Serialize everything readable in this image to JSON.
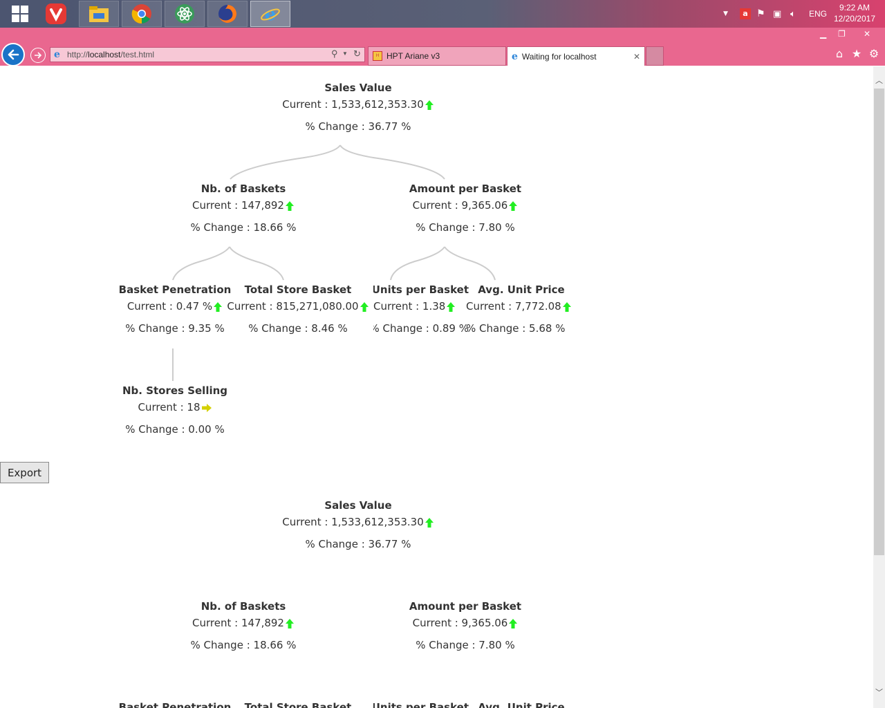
{
  "taskbar": {
    "apps": [
      "vivaldi-icon",
      "file-explorer-icon",
      "chrome-icon",
      "atom-icon",
      "firefox-icon",
      "internet-explorer-icon"
    ],
    "tray": {
      "language": "ENG"
    },
    "clock": {
      "time": "9:22 AM",
      "date": "12/20/2017"
    }
  },
  "browser": {
    "address": {
      "prefix": "http://",
      "host": "localhost",
      "path": "/test.html"
    },
    "tabs": [
      {
        "label": "HPT Ariane v3",
        "active": false
      },
      {
        "label": "Waiting for localhost",
        "active": true
      }
    ]
  },
  "tree1": {
    "root": {
      "title": "Sales Value",
      "current": "Current : 1,533,612,353.30",
      "change": "% Change : 36.77 %",
      "trend": "up"
    },
    "n1": {
      "title": "Nb. of Baskets",
      "current": "Current : 147,892",
      "change": "% Change : 18.66 %",
      "trend": "up"
    },
    "n2": {
      "title": "Amount per Basket",
      "current": "Current : 9,365.06",
      "change": "% Change : 7.80 %",
      "trend": "up"
    },
    "n11": {
      "title": "Basket Penetration",
      "current": "Current : 0.47 %",
      "change": "% Change : 9.35 %",
      "trend": "up"
    },
    "n12": {
      "title": "Total Store Basket",
      "current": "Current : 815,271,080.00",
      "change": "% Change : 8.46 %",
      "trend": "up"
    },
    "n21": {
      "title": "Units per Basket",
      "current": "Current : 1.38",
      "change": "% Change : 0.89 %",
      "trend": "up"
    },
    "n22": {
      "title": "Avg. Unit Price",
      "current": "Current : 7,772.08",
      "change": "% Change : 5.68 %",
      "trend": "up"
    },
    "n111": {
      "title": "Nb. Stores Selling",
      "current": "Current : 18",
      "change": "% Change : 0.00 %",
      "trend": "flat"
    }
  },
  "export_label": "Export",
  "tree2": {
    "root": {
      "title": "Sales Value",
      "current": "Current : 1,533,612,353.30",
      "change": "% Change : 36.77 %",
      "trend": "up"
    },
    "n1": {
      "title": "Nb. of Baskets",
      "current": "Current : 147,892",
      "change": "% Change : 18.66 %",
      "trend": "up"
    },
    "n2": {
      "title": "Amount per Basket",
      "current": "Current : 9,365.06",
      "change": "% Change : 7.80 %",
      "trend": "up"
    },
    "n11": {
      "title": "Basket Penetration"
    },
    "n12": {
      "title": "Total Store Basket"
    },
    "n21": {
      "title": "Units per Basket"
    },
    "n22": {
      "title": "Avg. Unit Price"
    }
  },
  "colors": {
    "up": "#22ee22",
    "flat": "#d4d000",
    "link": "#cccccc",
    "chrome": "#e9678f"
  }
}
